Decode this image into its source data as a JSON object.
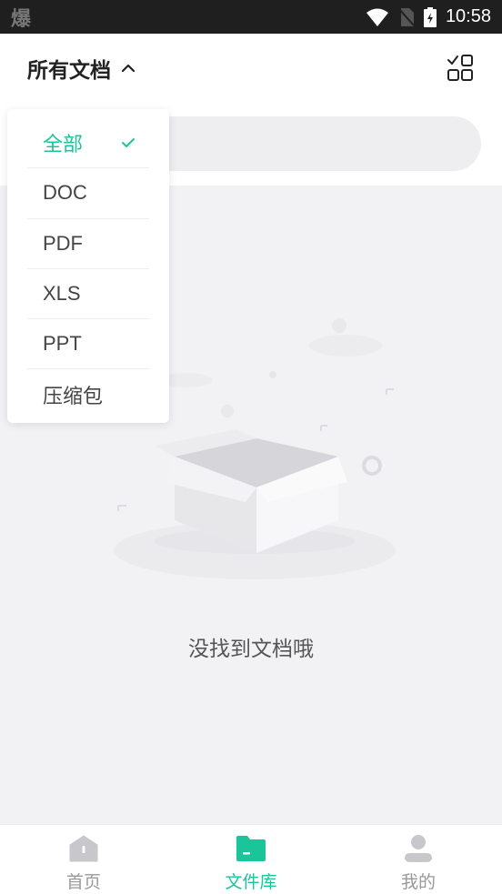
{
  "status_bar": {
    "time": "10:58",
    "left_glyph": "爆"
  },
  "header": {
    "title": "所有文档",
    "chevron_icon": "chevron-up-icon",
    "view_toggle_icon": "grid-list-icon"
  },
  "dropdown": {
    "items": [
      {
        "label": "全部",
        "selected": true
      },
      {
        "label": "DOC",
        "selected": false
      },
      {
        "label": "PDF",
        "selected": false
      },
      {
        "label": "XLS",
        "selected": false
      },
      {
        "label": "PPT",
        "selected": false
      },
      {
        "label": "压缩包",
        "selected": false
      }
    ]
  },
  "empty_state": {
    "text": "没找到文档哦",
    "illustration_icon": "empty-box-icon"
  },
  "bottom_nav": {
    "items": [
      {
        "label": "首页",
        "icon": "home-icon",
        "active": false
      },
      {
        "label": "文件库",
        "icon": "folder-icon",
        "active": true
      },
      {
        "label": "我的",
        "icon": "person-icon",
        "active": false
      }
    ]
  },
  "colors": {
    "accent": "#1bc59a",
    "background": "#f2f2f5",
    "inactive": "#999999"
  }
}
